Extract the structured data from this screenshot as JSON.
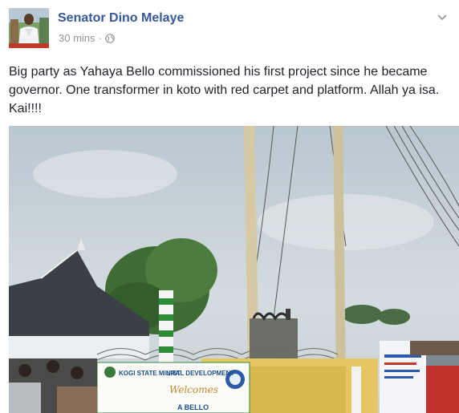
{
  "post": {
    "author": "Senator Dino Melaye",
    "timestamp": "30 mins",
    "separator": "·",
    "text": "Big party as Yahaya Bello commissioned his first project since he became governor. One transformer in koto with red carpet and platform. Allah ya isa. Kai!!!!",
    "icons": {
      "privacy": "globe-icon",
      "options": "chevron-down-icon"
    },
    "photo": {
      "banner_line1": "KOGI STATE MINIST",
      "banner_line2": "URAL DEVELOPMENT",
      "banner_script": "Welcomes",
      "banner_bottom": "A BELLO"
    }
  },
  "colors": {
    "author_link": "#365899",
    "meta_gray": "#90949c",
    "body_text": "#1d2129"
  }
}
